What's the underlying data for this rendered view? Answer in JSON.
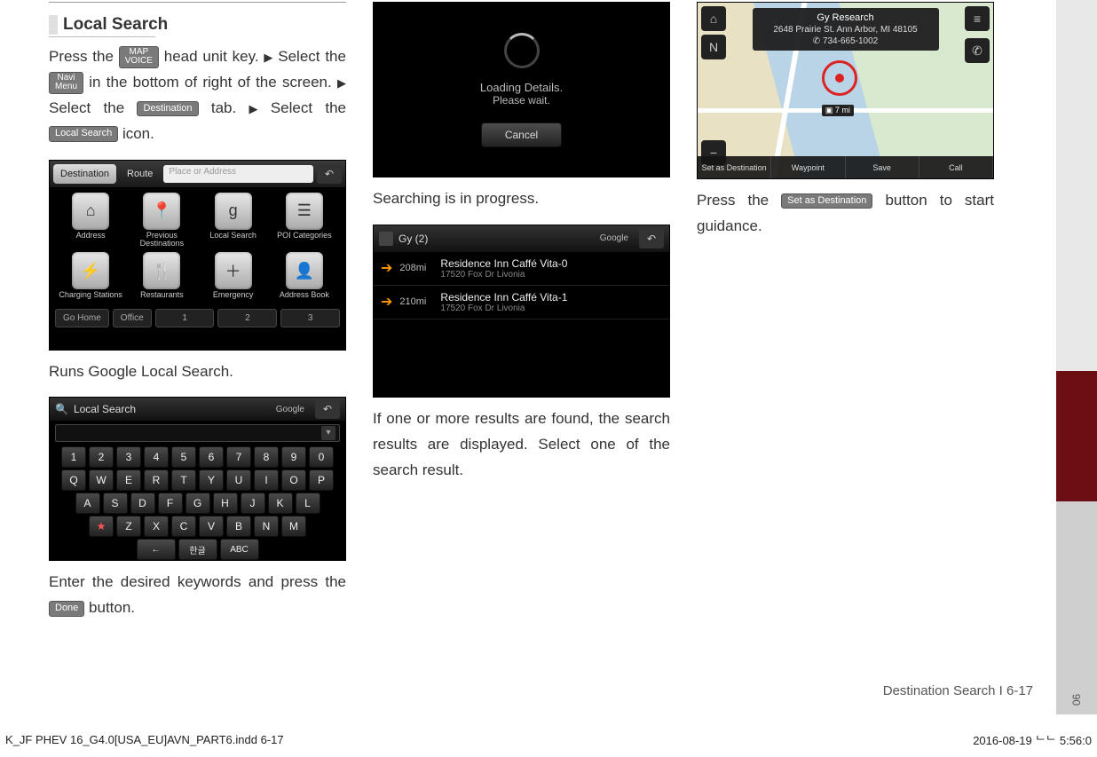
{
  "heading": "Local Search",
  "para1": {
    "pre_map": "Press the ",
    "map_btn_l1": "MAP",
    "map_btn_l2": "VOICE",
    "post_map": " head unit key. ",
    "post_map2": " Select the ",
    "navi_btn_l1": "Navi",
    "navi_btn_l2": "Menu",
    "post_navi": " in the bottom of right of the screen. ",
    "post_navi2": " Select the ",
    "dest_btn": "Destination",
    "post_dest": " tab. ",
    "post_dest2": " Select the ",
    "local_btn": "Local Search",
    "post_local": " icon."
  },
  "shot1": {
    "tab_active": "Destination",
    "tab2": "Route",
    "search_placeholder": "Place or Address",
    "items": [
      {
        "label": "Address",
        "glyph": "⌂"
      },
      {
        "label": "Previous Destinations",
        "glyph": "📍"
      },
      {
        "label": "Local Search",
        "glyph": "g"
      },
      {
        "label": "POI Categories",
        "glyph": "☰"
      },
      {
        "label": "Charging Stations",
        "glyph": "⚡"
      },
      {
        "label": "Restaurants",
        "glyph": "🍴"
      },
      {
        "label": "Emergency",
        "glyph": "＋"
      },
      {
        "label": "Address Book",
        "glyph": "👤"
      }
    ],
    "foot": [
      "Go Home",
      "Office",
      "1",
      "2",
      "3"
    ]
  },
  "caption_runs_google": "Runs Google Local Search.",
  "shot2": {
    "title": "Local Search",
    "google": "Google",
    "rows": [
      [
        "1",
        "2",
        "3",
        "4",
        "5",
        "6",
        "7",
        "8",
        "9",
        "0"
      ],
      [
        "Q",
        "W",
        "E",
        "R",
        "T",
        "Y",
        "U",
        "I",
        "O",
        "P"
      ],
      [
        "A",
        "S",
        "D",
        "F",
        "G",
        "H",
        "J",
        "K",
        "L"
      ],
      [
        "Z",
        "X",
        "C",
        "V",
        "B",
        "N",
        "M"
      ]
    ],
    "bottom_extra_left": "★",
    "bottom_extra": [
      "←",
      "한글",
      "ABC"
    ]
  },
  "caption_enter": {
    "pre": "Enter the desired keywords and press the ",
    "btn": "Done",
    "post": " button."
  },
  "shot3": {
    "line1": "Loading Details.",
    "line2": "Please wait.",
    "cancel": "Cancel"
  },
  "caption_searching": "Searching is in progress.",
  "shot4": {
    "title": "Gy (2)",
    "google": "Google",
    "rows": [
      {
        "dist": "208mi",
        "name": "Residence Inn Caffé Vita-0",
        "addr": "17520 Fox Dr Livonia"
      },
      {
        "dist": "210mi",
        "name": "Residence Inn Caffé Vita-1",
        "addr": "17520 Fox Dr Livonia"
      }
    ]
  },
  "caption_results": "If one or more results are found, the search results are displayed. Select one of the search result.",
  "shot5": {
    "biz": "Gy Research",
    "addr": "2648 Prairie St. Ann Arbor, MI 48105",
    "phone": "✆ 734-665-1002",
    "distance_flag": "▣ 7 mi",
    "bottom": [
      "Set as Destination",
      "Waypoint",
      "Save",
      "Call"
    ]
  },
  "caption_setdest": {
    "pre": "Press the ",
    "btn": "Set as Destination",
    "post": " button to start guidance."
  },
  "page_label": "Destination Search I 6-17",
  "side_tab_num": "06",
  "footer_file": "K_JF PHEV 16_G4.0[USA_EU]AVN_PART6.indd   6-17",
  "footer_date": "2016-08-19   ᄂᄂ 5:56:0"
}
